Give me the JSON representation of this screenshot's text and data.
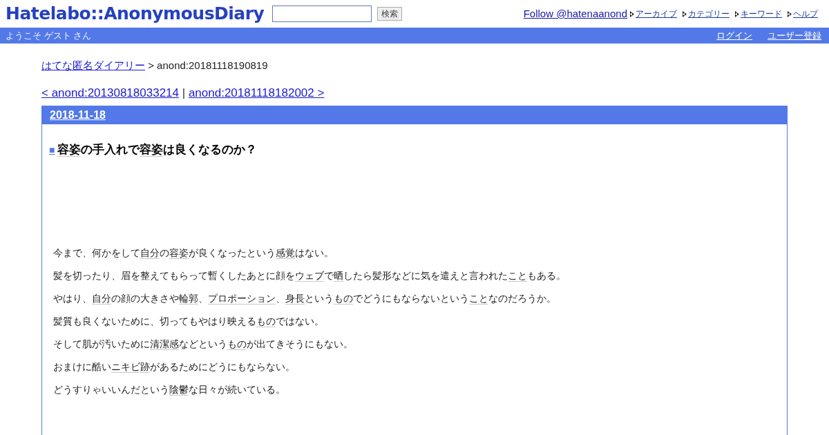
{
  "header": {
    "logo": "Hatelabo::AnonymousDiary",
    "search": {
      "button": "検索"
    },
    "follow_link": "Follow @hatenaanond",
    "nav_links": [
      "アーカイブ",
      "カテゴリー",
      "キーワード",
      "ヘルプ"
    ]
  },
  "user_bar": {
    "greeting": "ようこそ ゲスト さん",
    "links": [
      "ログイン",
      "ユーザー登録"
    ]
  },
  "breadcrumb": {
    "link": "はてな匿名ダイアリー",
    "current": "> anond:20181118190819"
  },
  "pager": {
    "prev": "< anond:20130818033214",
    "separator": "|",
    "next": "anond:20181118182002 >"
  },
  "entry": {
    "date": "2018-11-18",
    "marker": "■",
    "title": [
      {
        "kind": "keyword",
        "text": "容姿"
      },
      {
        "kind": "text",
        "text": "の手入れで"
      },
      {
        "kind": "keyword",
        "text": "容姿"
      },
      {
        "kind": "text",
        "text": "は良くなるのか？"
      }
    ],
    "paragraphs": [
      [
        {
          "kind": "text",
          "text": "今まで、何かをして"
        },
        {
          "kind": "keyword",
          "text": "自分"
        },
        {
          "kind": "text",
          "text": "の"
        },
        {
          "kind": "keyword",
          "text": "容姿"
        },
        {
          "kind": "text",
          "text": "が良くなったという"
        },
        {
          "kind": "keyword",
          "text": "感覚"
        },
        {
          "kind": "text",
          "text": "はない。"
        }
      ],
      [
        {
          "kind": "text",
          "text": "髪を切ったり、眉を整えてもらって暫くしたあとに顔を"
        },
        {
          "kind": "keyword",
          "text": "ウェブ"
        },
        {
          "kind": "text",
          "text": "で"
        },
        {
          "kind": "keyword",
          "text": "晒"
        },
        {
          "kind": "text",
          "text": "したら髪形などに気を遣えと言われた"
        },
        {
          "kind": "keyword",
          "text": "こと"
        },
        {
          "kind": "text",
          "text": "もある。"
        }
      ],
      [
        {
          "kind": "text",
          "text": "やはり、"
        },
        {
          "kind": "keyword",
          "text": "自分"
        },
        {
          "kind": "text",
          "text": "の顔の大きさや"
        },
        {
          "kind": "keyword",
          "text": "輪郭"
        },
        {
          "kind": "text",
          "text": "、"
        },
        {
          "kind": "keyword",
          "text": "プロポーション"
        },
        {
          "kind": "text",
          "text": "、"
        },
        {
          "kind": "keyword",
          "text": "身長"
        },
        {
          "kind": "text",
          "text": "という"
        },
        {
          "kind": "keyword",
          "text": "もの"
        },
        {
          "kind": "text",
          "text": "でどうにもならないという"
        },
        {
          "kind": "keyword",
          "text": "こと"
        },
        {
          "kind": "text",
          "text": "なのだろうか。"
        }
      ],
      [
        {
          "kind": "text",
          "text": "髪質も良くないために、切ってもやはり映える"
        },
        {
          "kind": "keyword",
          "text": "もの"
        },
        {
          "kind": "text",
          "text": "ではない。"
        }
      ],
      [
        {
          "kind": "text",
          "text": "そして肌が汚いために"
        },
        {
          "kind": "keyword",
          "text": "清潔感"
        },
        {
          "kind": "text",
          "text": "などという"
        },
        {
          "kind": "keyword",
          "text": "もの"
        },
        {
          "kind": "text",
          "text": "が出てきそうにもない。"
        }
      ],
      [
        {
          "kind": "text",
          "text": "おまけに酷い"
        },
        {
          "kind": "keyword",
          "text": "ニキビ跡"
        },
        {
          "kind": "text",
          "text": "があるためにどうにもならない。"
        }
      ],
      [
        {
          "kind": "text",
          "text": "どうすりゃいいんだという"
        },
        {
          "kind": "keyword",
          "text": "陰鬱"
        },
        {
          "kind": "text",
          "text": "な日々が続いている。"
        }
      ]
    ]
  }
}
